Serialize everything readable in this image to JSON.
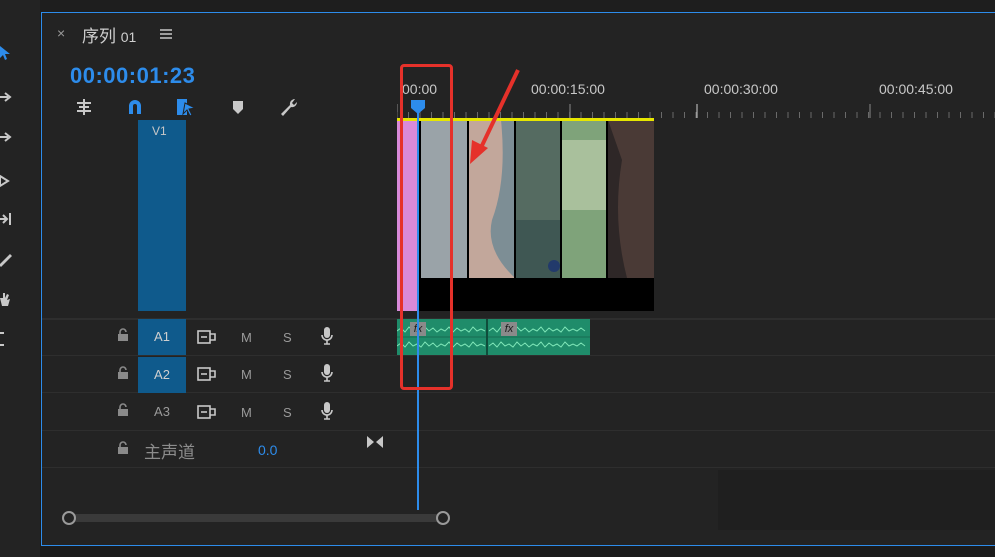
{
  "sequence": {
    "close_glyph": "×",
    "title": "序列",
    "title_num": "01",
    "timecode": "00:00:01:23"
  },
  "ruler": {
    "labels": [
      "00:00",
      "00:00:15:00",
      "00:00:30:00",
      "00:00:45:00"
    ]
  },
  "tracks": {
    "video": [
      {
        "label": "V1"
      }
    ],
    "audio": [
      {
        "label": "A1",
        "mute": "M",
        "solo": "S",
        "active": true
      },
      {
        "label": "A2",
        "mute": "M",
        "solo": "S",
        "active": false
      },
      {
        "label": "A3",
        "mute": "M",
        "solo": "S",
        "active": false
      }
    ],
    "master": {
      "label": "主声道",
      "value": "0.0"
    }
  },
  "clips": {
    "audio_fx_labels": [
      "fx",
      "fx"
    ]
  },
  "colors": {
    "accent": "#2d8ceb",
    "track_active": "#0f5a8c",
    "audio_clip": "#1f8c6a",
    "annotation_red": "#e5312a",
    "work_area_yellow": "#e6e600",
    "render_pink": "#d98ad9"
  },
  "icons": {
    "toolbar_left": [
      "selection-tool-icon",
      "track-select-forward-icon",
      "track-select-backward-icon",
      "ripple-edit-icon",
      "rolling-edit-icon",
      "razor-icon",
      "hand-icon",
      "type-icon"
    ],
    "timeline_toolbar": [
      "insert-sequence-nest-icon",
      "snap-magnet-icon",
      "linked-selection-icon",
      "add-marker-icon",
      "wrench-settings-icon"
    ]
  }
}
